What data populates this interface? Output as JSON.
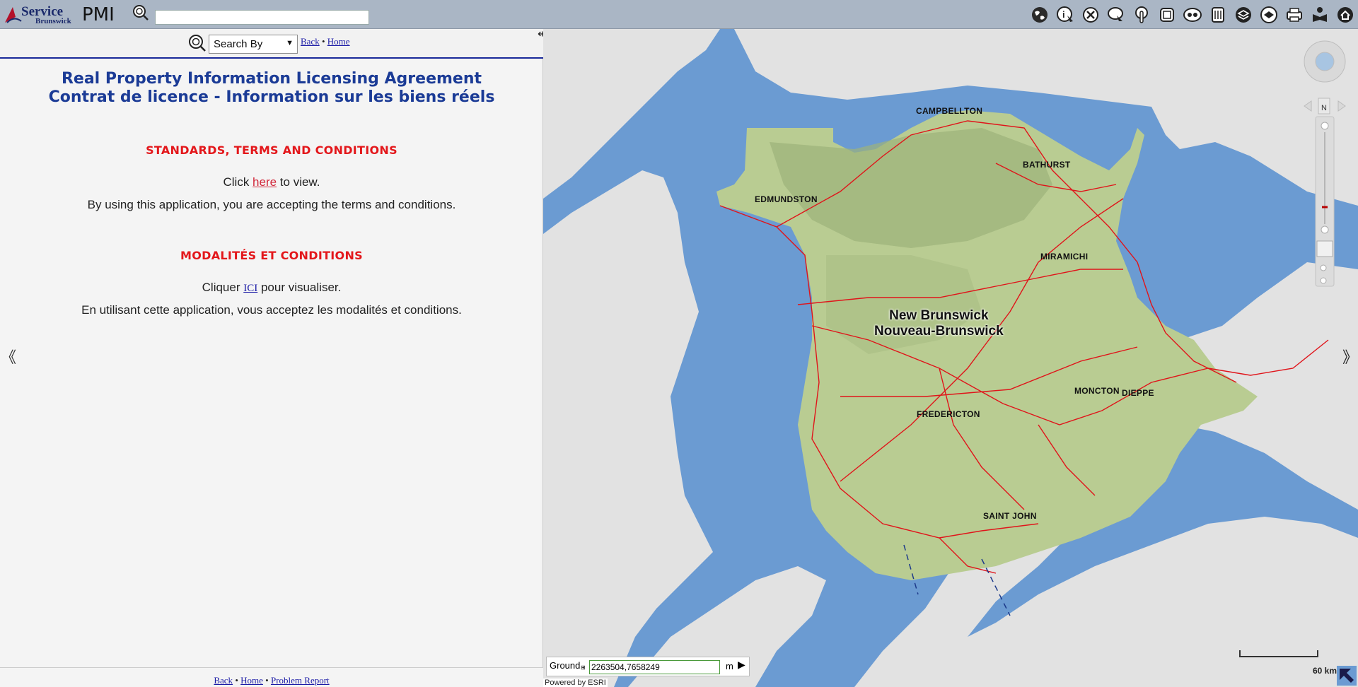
{
  "header": {
    "logo_text": "Service New Brunswick",
    "logo_service": "Service",
    "logo_brunswick": "Brunswick",
    "app_title": "PMI",
    "search_placeholder": "",
    "toolbar_icons": [
      "globe-icon",
      "identify-icon",
      "clear-icon",
      "select-icon",
      "touch-icon",
      "extent-icon",
      "overview-icon",
      "measure-icon",
      "layers-icon",
      "basemap-icon",
      "print-icon",
      "reading-icon",
      "home-icon"
    ]
  },
  "left": {
    "search_by_label": "Search By",
    "back": "Back",
    "home": "Home",
    "bullet": "•",
    "title_en": "Real Property Information Licensing Agreement",
    "title_fr": "Contrat de licence - Information sur les biens réels",
    "heading_en": "STANDARDS, TERMS AND CONDITIONS",
    "click_prefix": "Click ",
    "click_link": "here",
    "click_suffix": " to view.",
    "accept_en": "By using this application, you are accepting the terms and conditions.",
    "heading_fr": "MODALITÉS ET CONDITIONS",
    "cliquer_prefix": "Cliquer ",
    "cliquer_link": "ICI",
    "cliquer_suffix": " pour visualiser.",
    "accept_fr": "En utilisant cette application, vous acceptez les modalités et conditions.",
    "footer_back": "Back",
    "footer_home": "Home",
    "footer_report": "Problem Report",
    "collapse_glyph": "《"
  },
  "map": {
    "province_en": "New Brunswick",
    "province_fr": "Nouveau-Brunswick",
    "cities": [
      "CAMPBELLTON",
      "BATHURST",
      "EDMUNDSTON",
      "MIRAMICHI",
      "MONCTON",
      "DIEPPE",
      "FREDERICTON",
      "SAINT JOHN"
    ],
    "north_label": "N",
    "coord_label": "Ground",
    "coord_value": "2263504,7658249",
    "coord_unit": "m",
    "powered_by": "Powered by ESRI",
    "scale_label": "60 km",
    "expand_glyph": "》",
    "colors": {
      "water": "#6b9bd2",
      "land": "#e2e2e2",
      "nb_land": "#b9cc92",
      "roads": "#e0141a"
    }
  }
}
